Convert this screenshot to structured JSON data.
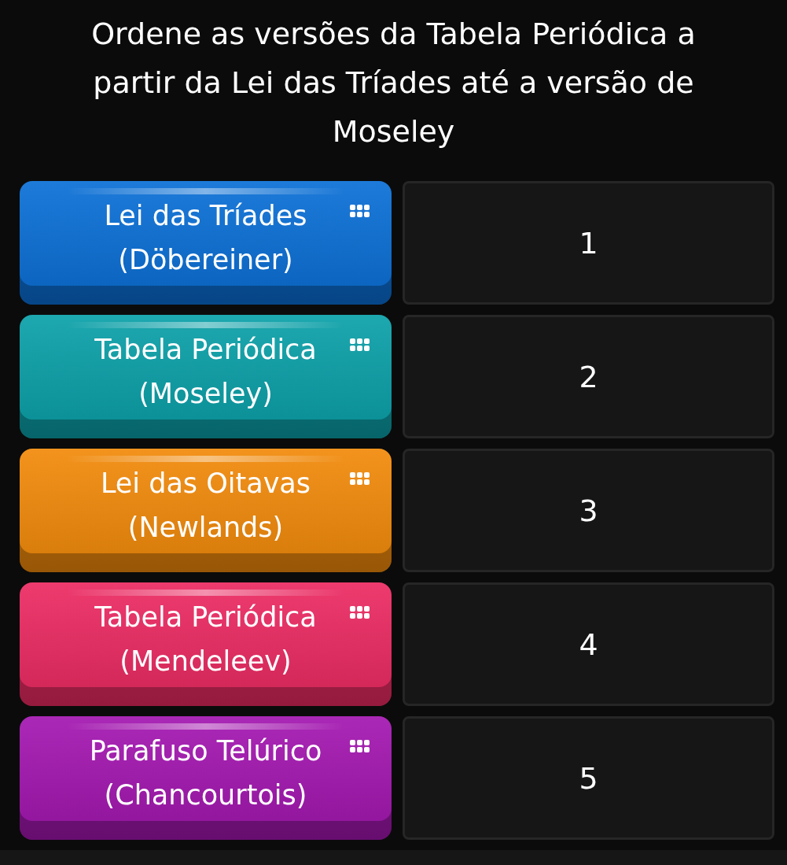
{
  "title": "Ordene as versões da Tabela Periódica a partir da Lei das Tríades até a versão de Moseley",
  "items": [
    {
      "line1": "Lei das Tríades",
      "line2": "(Döbereiner)",
      "color": "#0a6fd6"
    },
    {
      "line1": "Tabela Periódica",
      "line2": "(Moseley)",
      "color": "#0aa0a8"
    },
    {
      "line1": "Lei das Oitavas",
      "line2": "(Newlands)",
      "color": "#f28a0a"
    },
    {
      "line1": "Tabela Periódica",
      "line2": "(Mendeleev)",
      "color": "#ec2a62"
    },
    {
      "line1": "Parafuso Telúrico",
      "line2": "(Chancourtois)",
      "color": "#a316b0"
    }
  ],
  "slots": [
    "1",
    "2",
    "3",
    "4",
    "5"
  ]
}
